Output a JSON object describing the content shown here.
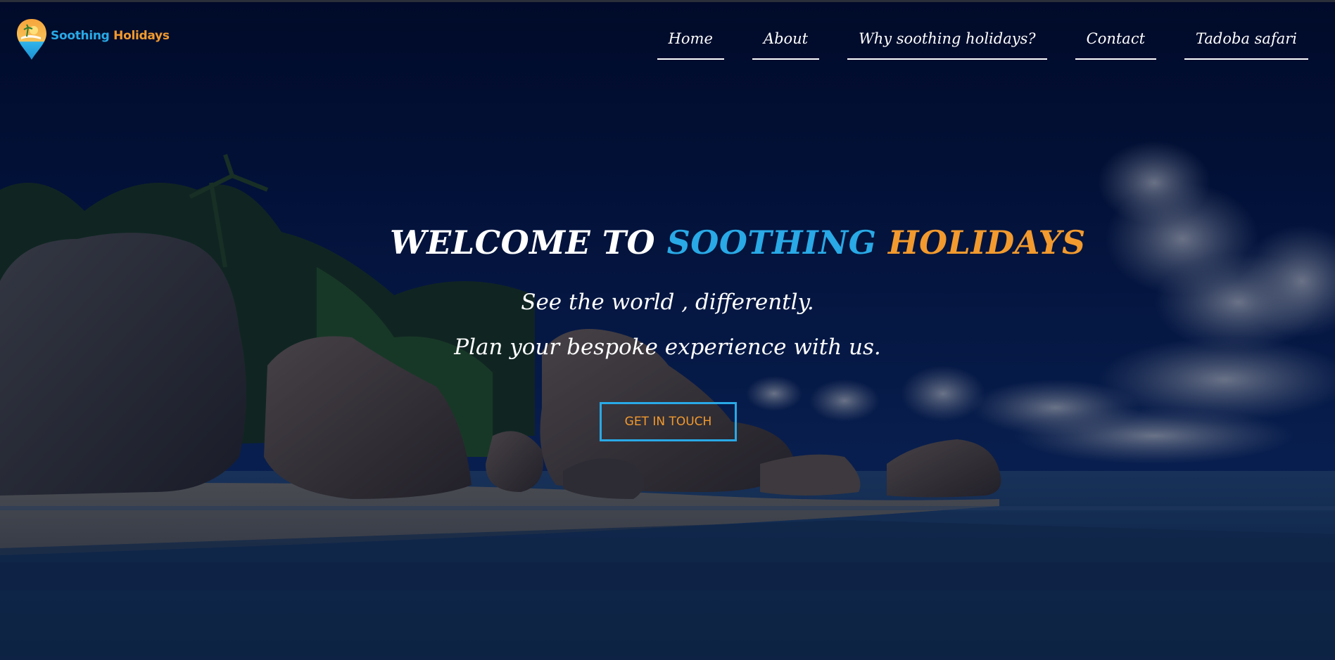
{
  "logo": {
    "word1": "Soothing",
    "word2": "Holidays",
    "icon": "map-pin-beach-icon"
  },
  "nav": {
    "items": [
      {
        "label": "Home"
      },
      {
        "label": "About"
      },
      {
        "label": "Why soothing holidays?"
      },
      {
        "label": "Contact"
      },
      {
        "label": "Tadoba safari"
      }
    ]
  },
  "hero": {
    "title_part1": "WELCOME TO",
    "title_part2": "SOOTHING",
    "title_part3": "HOLIDAYS",
    "subtitle1": "See the world , differently.",
    "subtitle2": "Plan your bespoke experience with us.",
    "cta_label": "GET IN TOUCH",
    "background": "tropical-beach-photo"
  },
  "colors": {
    "brand_blue": "#29a9e6",
    "brand_orange": "#f29a2e",
    "text": "#ffffff",
    "overlay": "#0b1a3c"
  }
}
